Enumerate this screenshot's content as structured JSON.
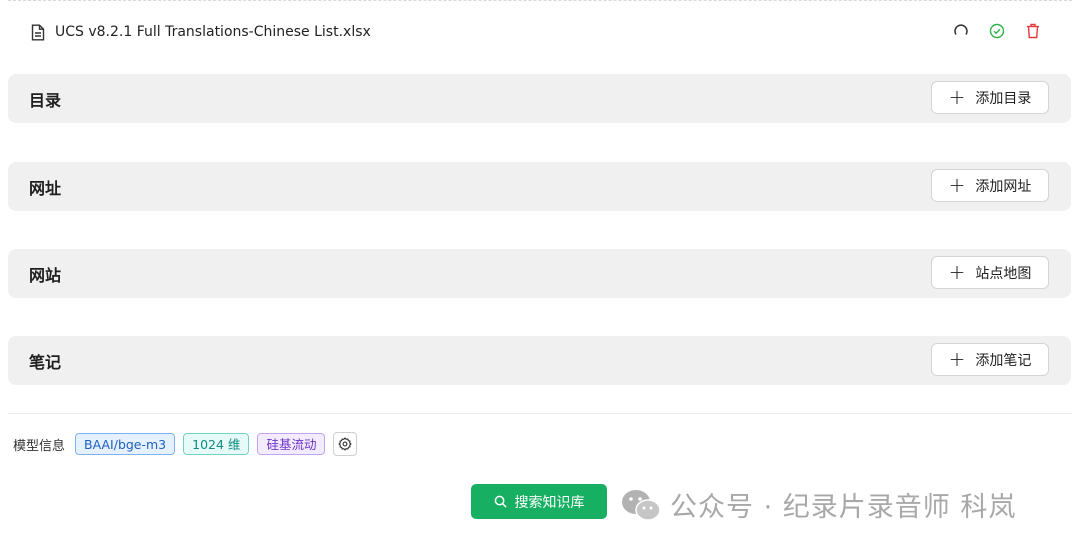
{
  "file": {
    "name": "UCS v8.2.1 Full Translations-Chinese List.xlsx",
    "icons": [
      "file-icon",
      "refresh-icon",
      "check-circle-icon",
      "trash-icon"
    ]
  },
  "sections": [
    {
      "title": "目录",
      "button": "添加目录"
    },
    {
      "title": "网址",
      "button": "添加网址"
    },
    {
      "title": "网站",
      "button": "站点地图"
    },
    {
      "title": "笔记",
      "button": "添加笔记"
    }
  ],
  "model": {
    "label": "模型信息",
    "name": "BAAI/bge-m3",
    "dimension": "1024 维",
    "provider": "硅基流动"
  },
  "search": {
    "label": "搜索知识库"
  },
  "watermark": {
    "text": "公众号 · 纪录片录音师 科岚"
  },
  "colors": {
    "primary": "#17b063",
    "success": "#2fb34a",
    "danger": "#e5393b",
    "section_bg": "#f0f0f0"
  }
}
